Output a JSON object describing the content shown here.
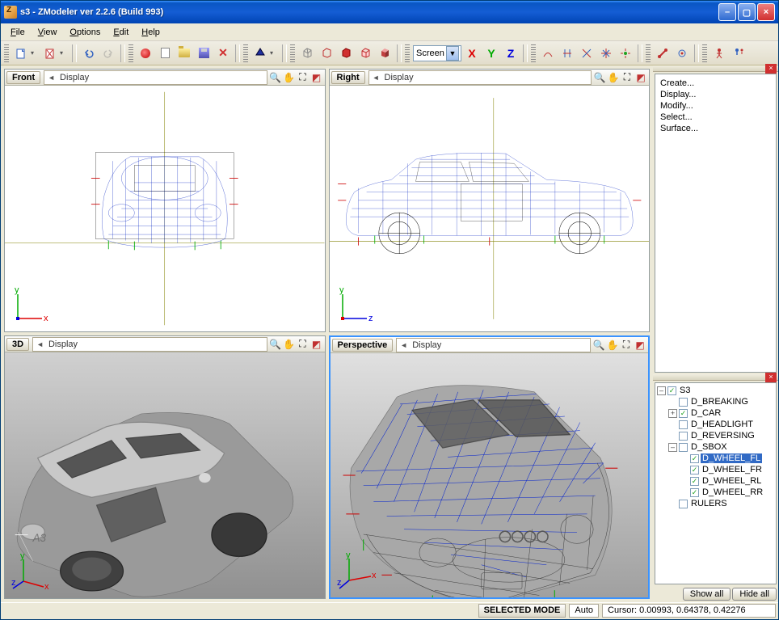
{
  "window": {
    "title": "s3 - ZModeler ver 2.2.6 (Build 993)"
  },
  "menu": {
    "file": "File",
    "view": "View",
    "options": "Options",
    "edit": "Edit",
    "help": "Help"
  },
  "toolbar": {
    "combo_view": "Screen",
    "x": "X",
    "y": "Y",
    "z": "Z"
  },
  "viewports": {
    "front": {
      "label": "Front",
      "display": "Display"
    },
    "right": {
      "label": "Right",
      "display": "Display"
    },
    "three_d": {
      "label": "3D",
      "display": "Display"
    },
    "perspective": {
      "label": "Perspective",
      "display": "Display"
    }
  },
  "commands": {
    "create": "Create...",
    "display": "Display...",
    "modify": "Modify...",
    "select": "Select...",
    "surface": "Surface..."
  },
  "tree": {
    "s3": "S3",
    "d_breaking": "D_BREAKING",
    "d_car": "D_CAR",
    "d_headlight": "D_HEADLIGHT",
    "d_reversing": "D_REVERSING",
    "d_sbox": "D_SBOX",
    "d_wheel_fl": "D_WHEEL_FL",
    "d_wheel_fr": "D_WHEEL_FR",
    "d_wheel_rl": "D_WHEEL_RL",
    "d_wheel_rr": "D_WHEEL_RR",
    "rulers": "RULERS",
    "show_all": "Show all",
    "hide_all": "Hide all"
  },
  "status": {
    "mode": "SELECTED MODE",
    "auto": "Auto",
    "cursor": "Cursor: 0.00993, 0.64378, 0.42276"
  }
}
